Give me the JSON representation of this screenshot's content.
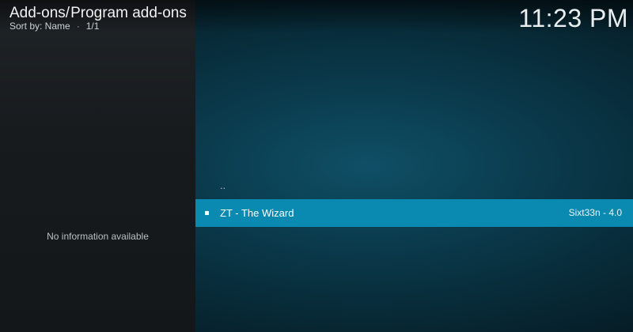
{
  "header": {
    "breadcrumb_root": "Add-ons",
    "breadcrumb_sep": "/",
    "breadcrumb_current": "Program add-ons",
    "sort_label": "Sort by: Name",
    "sort_dot": "·",
    "page_count": "1/1",
    "clock": "11:23 PM"
  },
  "info_panel": {
    "message": "No information available"
  },
  "list": {
    "parent_label": "..",
    "items": [
      {
        "name": "ZT - The Wizard",
        "meta": "Sixt33n - 4.0"
      }
    ]
  }
}
